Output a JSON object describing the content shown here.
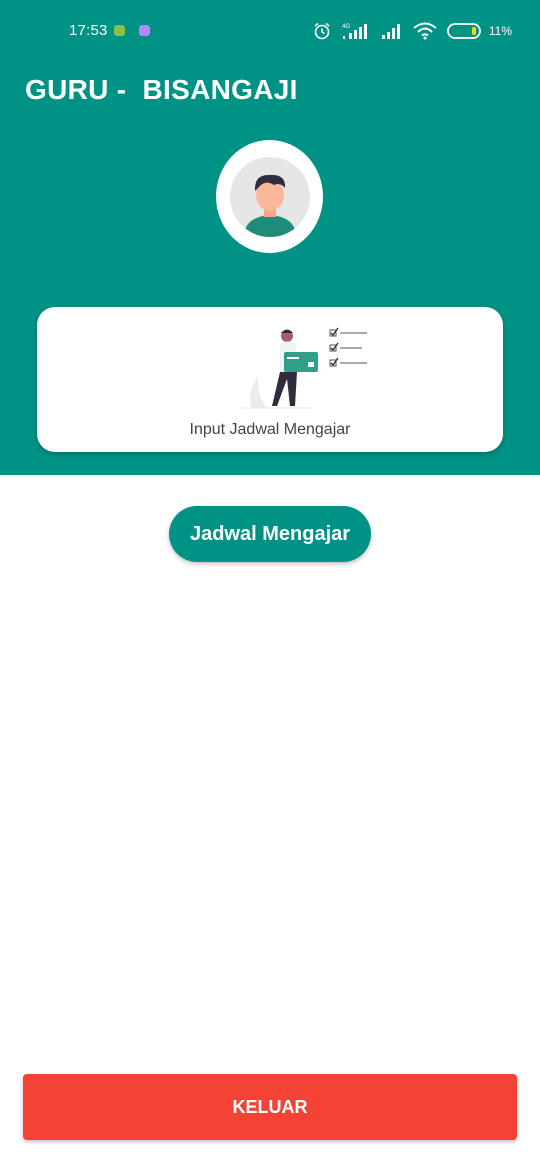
{
  "status_bar": {
    "time": "17:53",
    "network_label": "4G",
    "battery_percent": "11%",
    "icons": [
      "app-notification-icon",
      "message-notification-icon",
      "alarm-icon",
      "signal-icon",
      "signal-icon",
      "wifi-icon",
      "battery-icon"
    ]
  },
  "header": {
    "title": "GURU -  BISANGAJI",
    "background_color": "#009385",
    "avatar_icon": "user-avatar-icon"
  },
  "menu_card": {
    "label": "Input Jadwal Mengajar",
    "illustration": "schedule-checklist-illustration"
  },
  "actions": {
    "jadwal_label": "Jadwal Mengajar",
    "logout_label": "KELUAR",
    "logout_color": "#f44336"
  }
}
